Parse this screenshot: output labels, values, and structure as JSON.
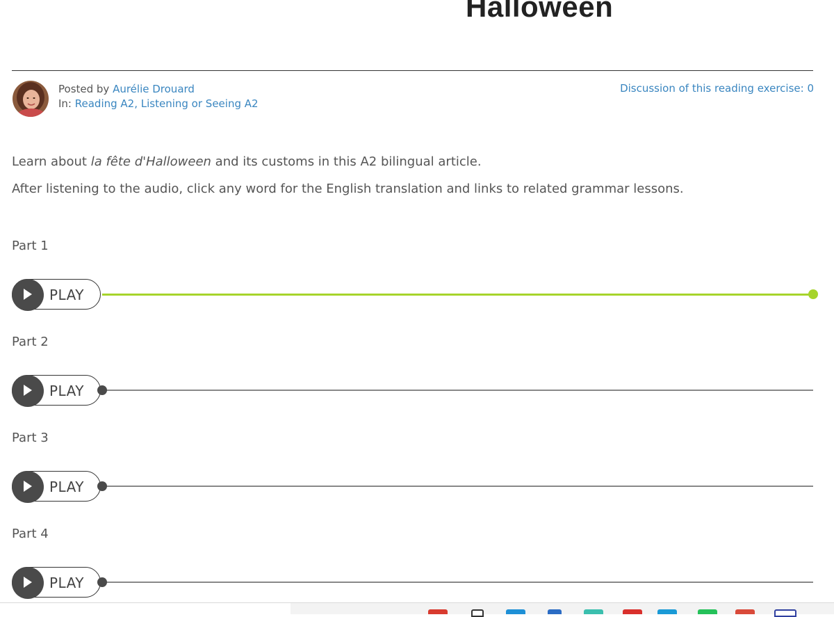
{
  "article": {
    "title": "Halloween",
    "posted_by_prefix": "Posted by ",
    "author": "Aurélie Drouard",
    "in_prefix": "In: ",
    "categories": "Reading A2, Listening or Seeing A2",
    "discussion_label": "Discussion of this reading exercise: 0",
    "intro_line1_before": "Learn about ",
    "intro_line1_italic": "la fête d'Halloween",
    "intro_line1_after": " and its customs in this A2 bilingual article.",
    "intro_line2": "After listening to the audio, click any word for the English translation and links to related grammar lessons."
  },
  "parts": [
    {
      "label": "Part 1",
      "button": "PLAY",
      "progress": 1.0
    },
    {
      "label": "Part 2",
      "button": "PLAY",
      "progress": 0.0
    },
    {
      "label": "Part 3",
      "button": "PLAY",
      "progress": 0.0
    },
    {
      "label": "Part 4",
      "button": "PLAY",
      "progress": 0.0
    }
  ],
  "colors": {
    "played": "#a6d42b",
    "unplayed": "#888888",
    "link": "#3a86c0"
  },
  "icons": {
    "play": "play-icon",
    "avatar": "author-avatar"
  }
}
